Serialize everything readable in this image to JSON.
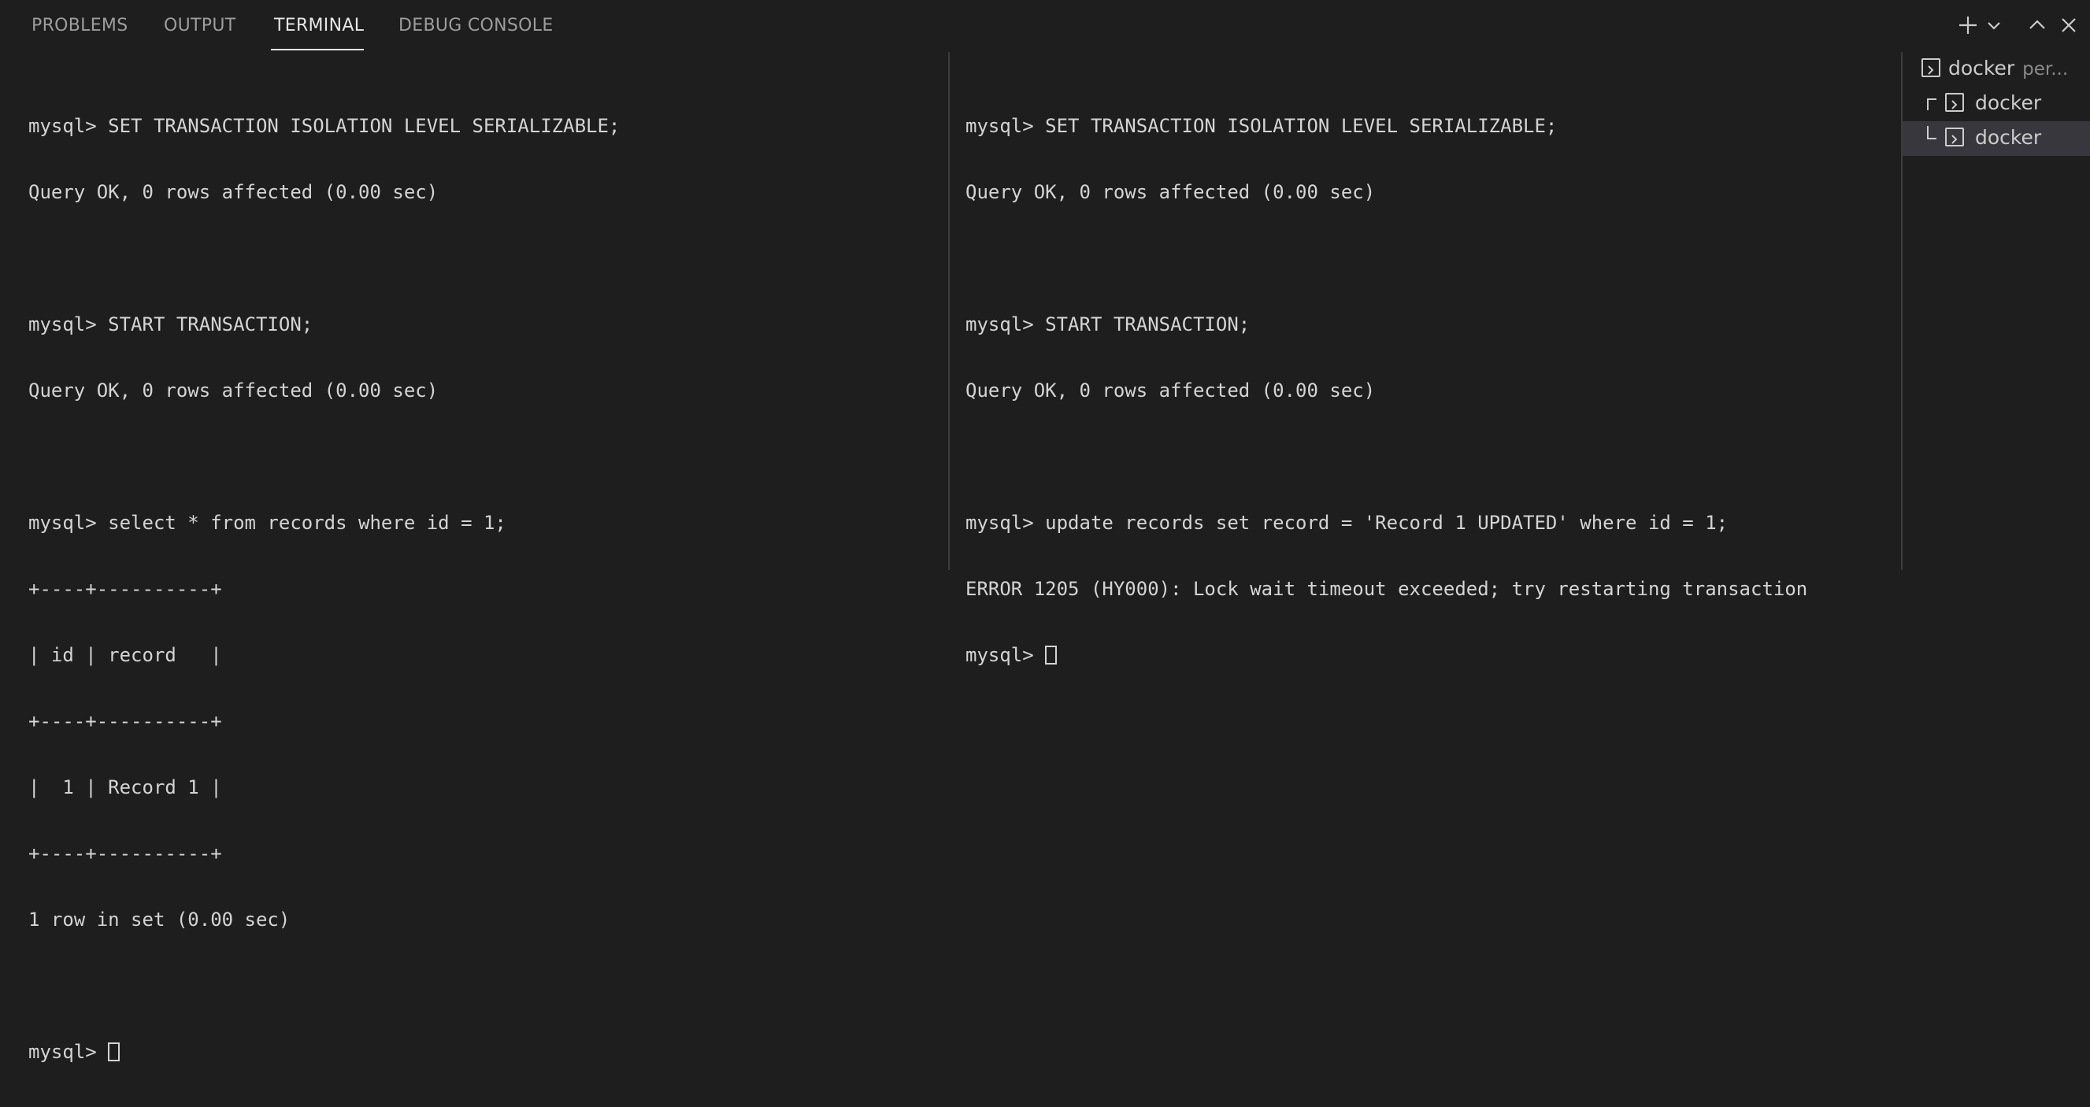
{
  "tabs": [
    {
      "label": "PROBLEMS"
    },
    {
      "label": "OUTPUT"
    },
    {
      "label": "TERMINAL",
      "active": true
    },
    {
      "label": "DEBUG CONSOLE"
    }
  ],
  "actions": {
    "icons": [
      "plus-icon",
      "chevron-down-icon",
      "chevron-up-icon",
      "close-icon"
    ]
  },
  "terminals": {
    "left": [
      "mysql> SET TRANSACTION ISOLATION LEVEL SERIALIZABLE;",
      "Query OK, 0 rows affected (0.00 sec)",
      "",
      "mysql> START TRANSACTION;",
      "Query OK, 0 rows affected (0.00 sec)",
      "",
      "mysql> select * from records where id = 1;",
      "+----+----------+",
      "| id | record   |",
      "+----+----------+",
      "|  1 | Record 1 |",
      "+----+----------+",
      "1 row in set (0.00 sec)",
      "",
      "mysql> "
    ],
    "right": [
      "mysql> SET TRANSACTION ISOLATION LEVEL SERIALIZABLE;",
      "Query OK, 0 rows affected (0.00 sec)",
      "",
      "mysql> START TRANSACTION;",
      "Query OK, 0 rows affected (0.00 sec)",
      "",
      "mysql> update records set record = 'Record 1 UPDATED' where id = 1;",
      "ERROR 1205 (HY000): Lock wait timeout exceeded; try restarting transaction",
      "mysql> "
    ]
  },
  "terminal_list": [
    {
      "name": "docker",
      "sub": "per...",
      "icon": "terminal-icon"
    },
    {
      "name": "docker",
      "icon": "terminal-icon"
    },
    {
      "name": "docker",
      "icon": "terminal-icon",
      "selected": true
    }
  ],
  "colors": {
    "background": "#1e1e1e",
    "text": "#d4d4d4",
    "selected_item": "#37373d"
  }
}
